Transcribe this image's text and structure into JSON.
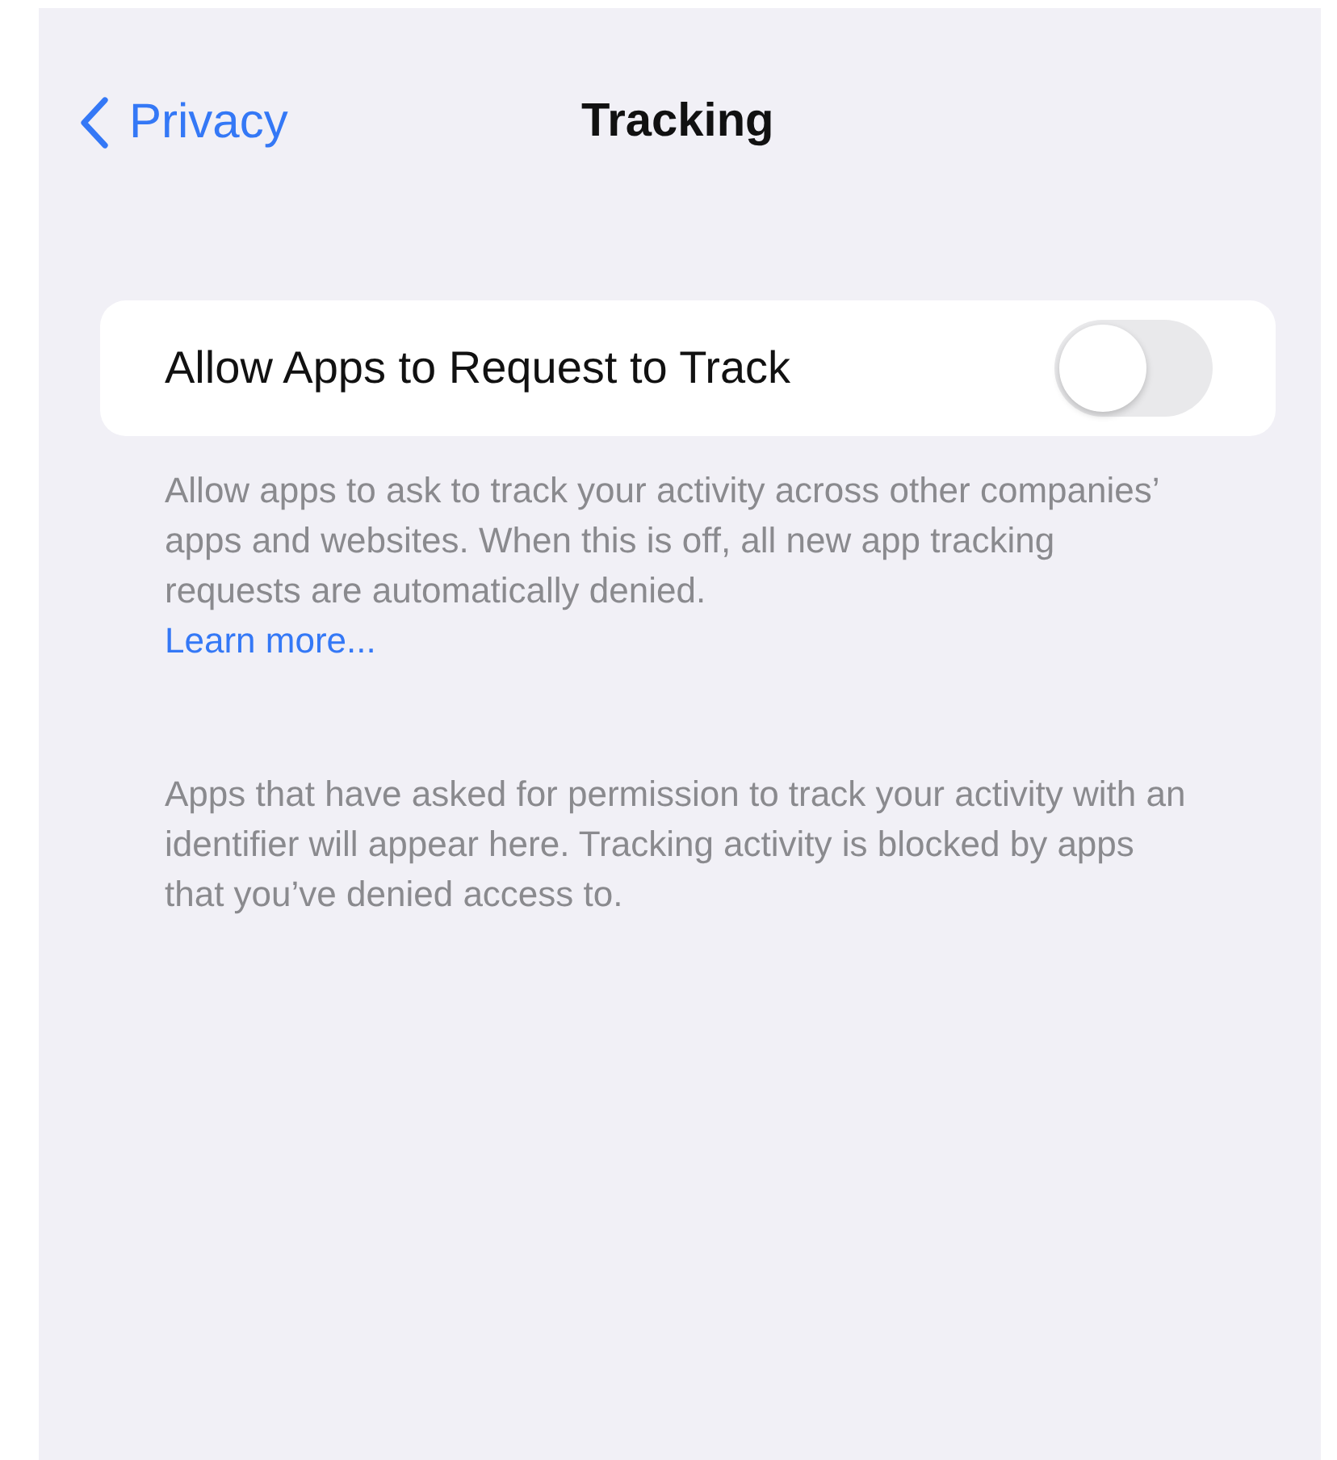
{
  "nav": {
    "back_label": "Privacy",
    "title": "Tracking"
  },
  "setting": {
    "label": "Allow Apps to Request to Track",
    "on": false
  },
  "footer": {
    "text": "Allow apps to ask to track your activity across other companies’ apps and websites. When this is off, all new app tracking requests are automatically denied.",
    "link": "Learn more..."
  },
  "note": "Apps that have asked for permission to track your activity with an identifier will appear here. Tracking activity is blocked by apps that you’ve denied access to."
}
